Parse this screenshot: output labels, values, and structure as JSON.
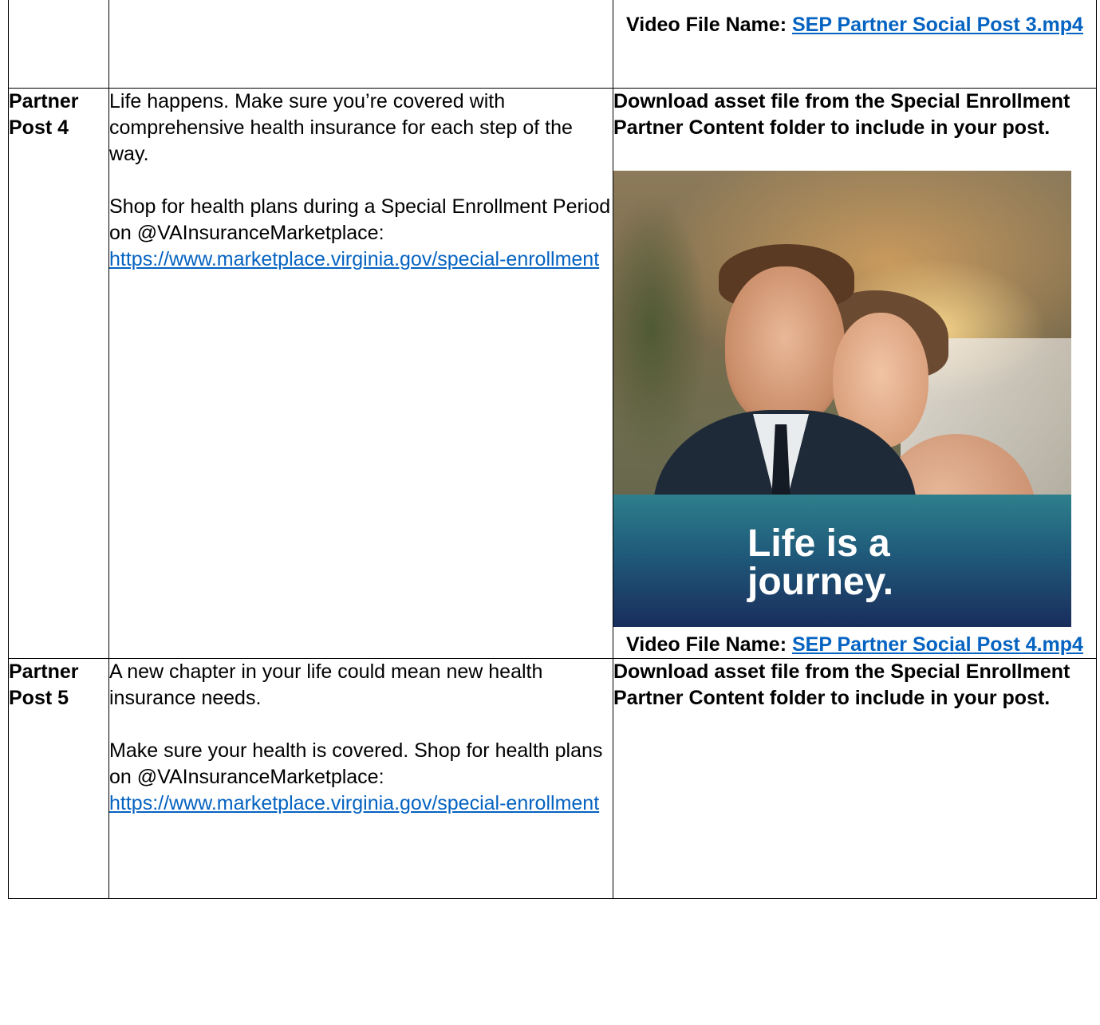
{
  "rows": [
    {
      "label": "",
      "copy": [],
      "asset": {
        "instruction": "",
        "video_prefix": "Video File Name:",
        "video_file": "SEP Partner Social Post 3.mp4"
      }
    },
    {
      "label": "Partner Post 4",
      "copy_p1": "Life happens. Make sure you’re covered with comprehensive health insurance for each step of the way.",
      "copy_p2_text": "Shop for health plans during a Special Enrollment Period on @VAInsuranceMarketplace:",
      "copy_link": "https://www.marketplace.virginia.gov/special-enrollment",
      "asset": {
        "instruction": "Download asset file from the Special Enrollment Partner Content folder to include in your post.",
        "image_headline": "Life is a journey.",
        "video_prefix": "Video File Name:",
        "video_file": "SEP Partner Social Post 4.mp4"
      }
    },
    {
      "label": "Partner Post 5",
      "copy_p1": "A new chapter in your life could mean new health insurance needs.",
      "copy_p2_text": "Make sure your health is covered. Shop for health plans on @VAInsuranceMarketplace:",
      "copy_link": "https://www.marketplace.virginia.gov/special-enrollment",
      "asset": {
        "instruction": "Download asset file from the Special Enrollment Partner Content folder to include in your post."
      }
    }
  ],
  "colors": {
    "link": "#0563c1",
    "border": "#000000",
    "band_top": "#2e7f8c",
    "band_bottom": "#1a2d5c"
  }
}
